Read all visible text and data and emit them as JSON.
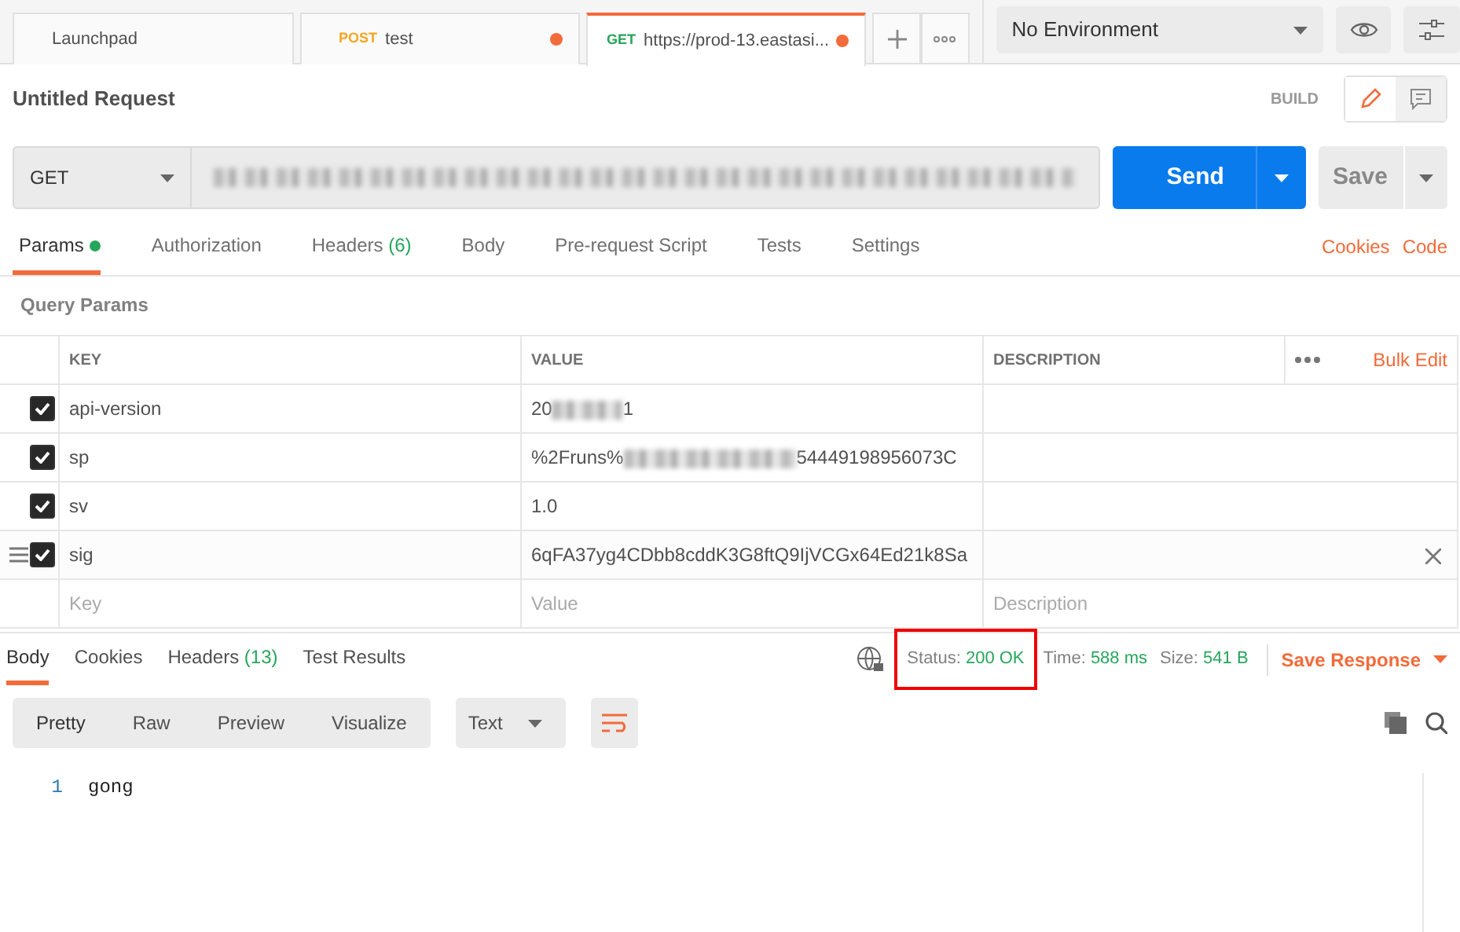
{
  "tabs": [
    {
      "label": "Launchpad",
      "unsaved": false,
      "selected": false
    },
    {
      "method": "POST",
      "label": "test",
      "unsaved": true,
      "selected": false
    },
    {
      "method": "GET",
      "label": "https://prod-13.eastasi...",
      "unsaved": true,
      "selected": true
    }
  ],
  "environment": "No Environment",
  "request_title": "Untitled Request",
  "mode_label": "BUILD",
  "method": "GET",
  "url": {
    "redacted": true
  },
  "send_label": "Send",
  "save_label": "Save",
  "request_tabs": [
    {
      "label": "Params",
      "dot": true,
      "selected": true
    },
    {
      "label": "Authorization",
      "dot": false,
      "selected": false
    },
    {
      "label": "Headers",
      "count": "(6)",
      "dot": false,
      "selected": false
    },
    {
      "label": "Body",
      "dot": false,
      "selected": false
    },
    {
      "label": "Pre-request Script",
      "dot": false,
      "selected": false
    },
    {
      "label": "Tests",
      "dot": false,
      "selected": false
    },
    {
      "label": "Settings",
      "dot": false,
      "selected": false
    }
  ],
  "request_links": [
    "Cookies",
    "Code"
  ],
  "section_title": "Query Params",
  "table": {
    "columns": [
      "KEY",
      "VALUE",
      "DESCRIPTION"
    ],
    "bulk_edit": "Bulk Edit",
    "rows": [
      {
        "key": "api-version",
        "value_prefix": "20",
        "redacted": true,
        "value_suffix": "1",
        "checked": true,
        "hovered": false
      },
      {
        "key": "sp",
        "value_prefix": "%2Fruns%",
        "redacted": true,
        "value_suffix": "54449198956073C",
        "checked": true,
        "hovered": false
      },
      {
        "key": "sv",
        "value_prefix": "1.0",
        "redacted": false,
        "checked": true,
        "hovered": false
      },
      {
        "key": "sig",
        "value_prefix": "6qFA37yg4CDbb8cddK3G8ftQ9IjVCGx64Ed21k8Sa",
        "redacted": false,
        "checked": true,
        "hovered": true
      }
    ],
    "new_row": {
      "key": "Key",
      "value": "Value",
      "description": "Description"
    }
  },
  "response_tabs": [
    {
      "label": "Body",
      "selected": true
    },
    {
      "label": "Cookies",
      "selected": false
    },
    {
      "label": "Headers",
      "count": "(13)",
      "selected": false
    },
    {
      "label": "Test Results",
      "selected": false
    }
  ],
  "stats": [
    {
      "label": "Status:",
      "value": "200 OK",
      "highlighted": true
    },
    {
      "label": "Time:",
      "value": "588 ms",
      "highlighted": false
    },
    {
      "label": "Size:",
      "value": "541 B",
      "highlighted": false
    }
  ],
  "save_response": "Save Response",
  "view_modes": [
    {
      "label": "Pretty",
      "selected": true
    },
    {
      "label": "Raw",
      "selected": false
    },
    {
      "label": "Preview",
      "selected": false
    },
    {
      "label": "Visualize",
      "selected": false
    }
  ],
  "format": "Text",
  "body_lines": [
    {
      "number": "1",
      "text": "gong"
    }
  ]
}
